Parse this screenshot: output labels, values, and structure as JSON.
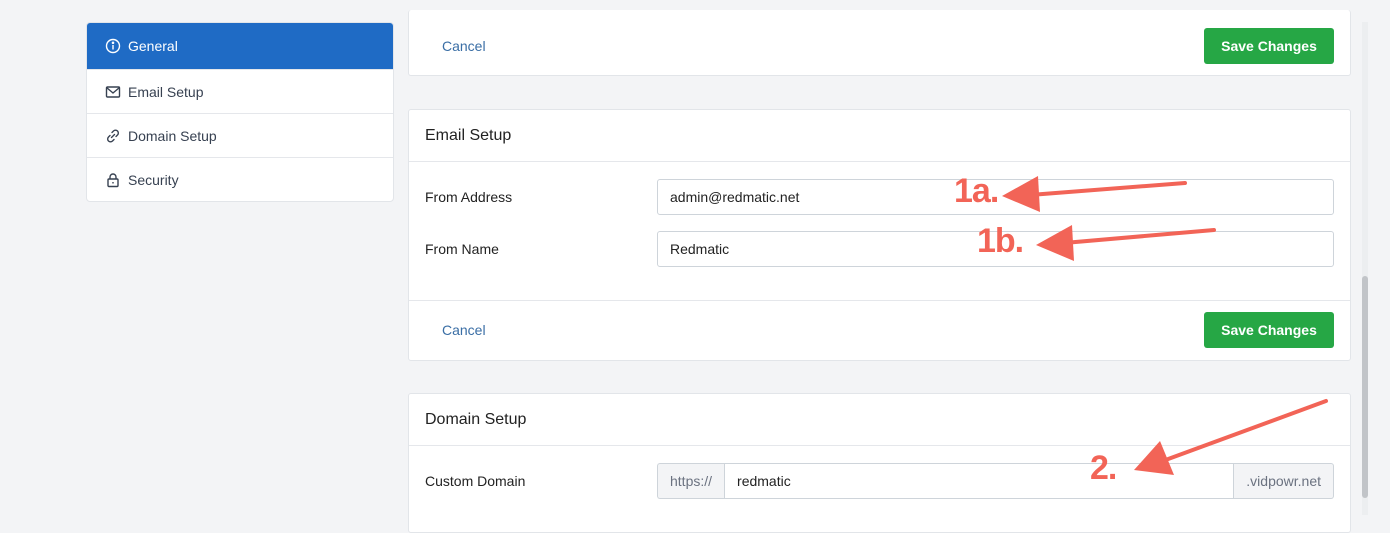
{
  "sidebar": {
    "items": [
      {
        "label": "General",
        "icon": "info-icon",
        "active": true
      },
      {
        "label": "Email Setup",
        "icon": "mail-icon",
        "active": false
      },
      {
        "label": "Domain Setup",
        "icon": "link-icon",
        "active": false
      },
      {
        "label": "Security",
        "icon": "lock-icon",
        "active": false
      }
    ]
  },
  "general_card": {
    "cancel_label": "Cancel",
    "save_label": "Save Changes"
  },
  "email_card": {
    "title": "Email Setup",
    "from_address_label": "From Address",
    "from_address_value": "admin@redmatic.net",
    "from_name_label": "From Name",
    "from_name_value": "Redmatic",
    "cancel_label": "Cancel",
    "save_label": "Save Changes"
  },
  "domain_card": {
    "title": "Domain Setup",
    "custom_domain_label": "Custom Domain",
    "prefix": "https://",
    "value": "redmatic",
    "suffix": ".vidpowr.net"
  },
  "annotations": {
    "a1": "1a.",
    "a2": "1b.",
    "a3": "2."
  },
  "colors": {
    "primary": "#1f6bc5",
    "success": "#26a745",
    "link": "#3a6ea5",
    "annotation": "#f26457"
  }
}
